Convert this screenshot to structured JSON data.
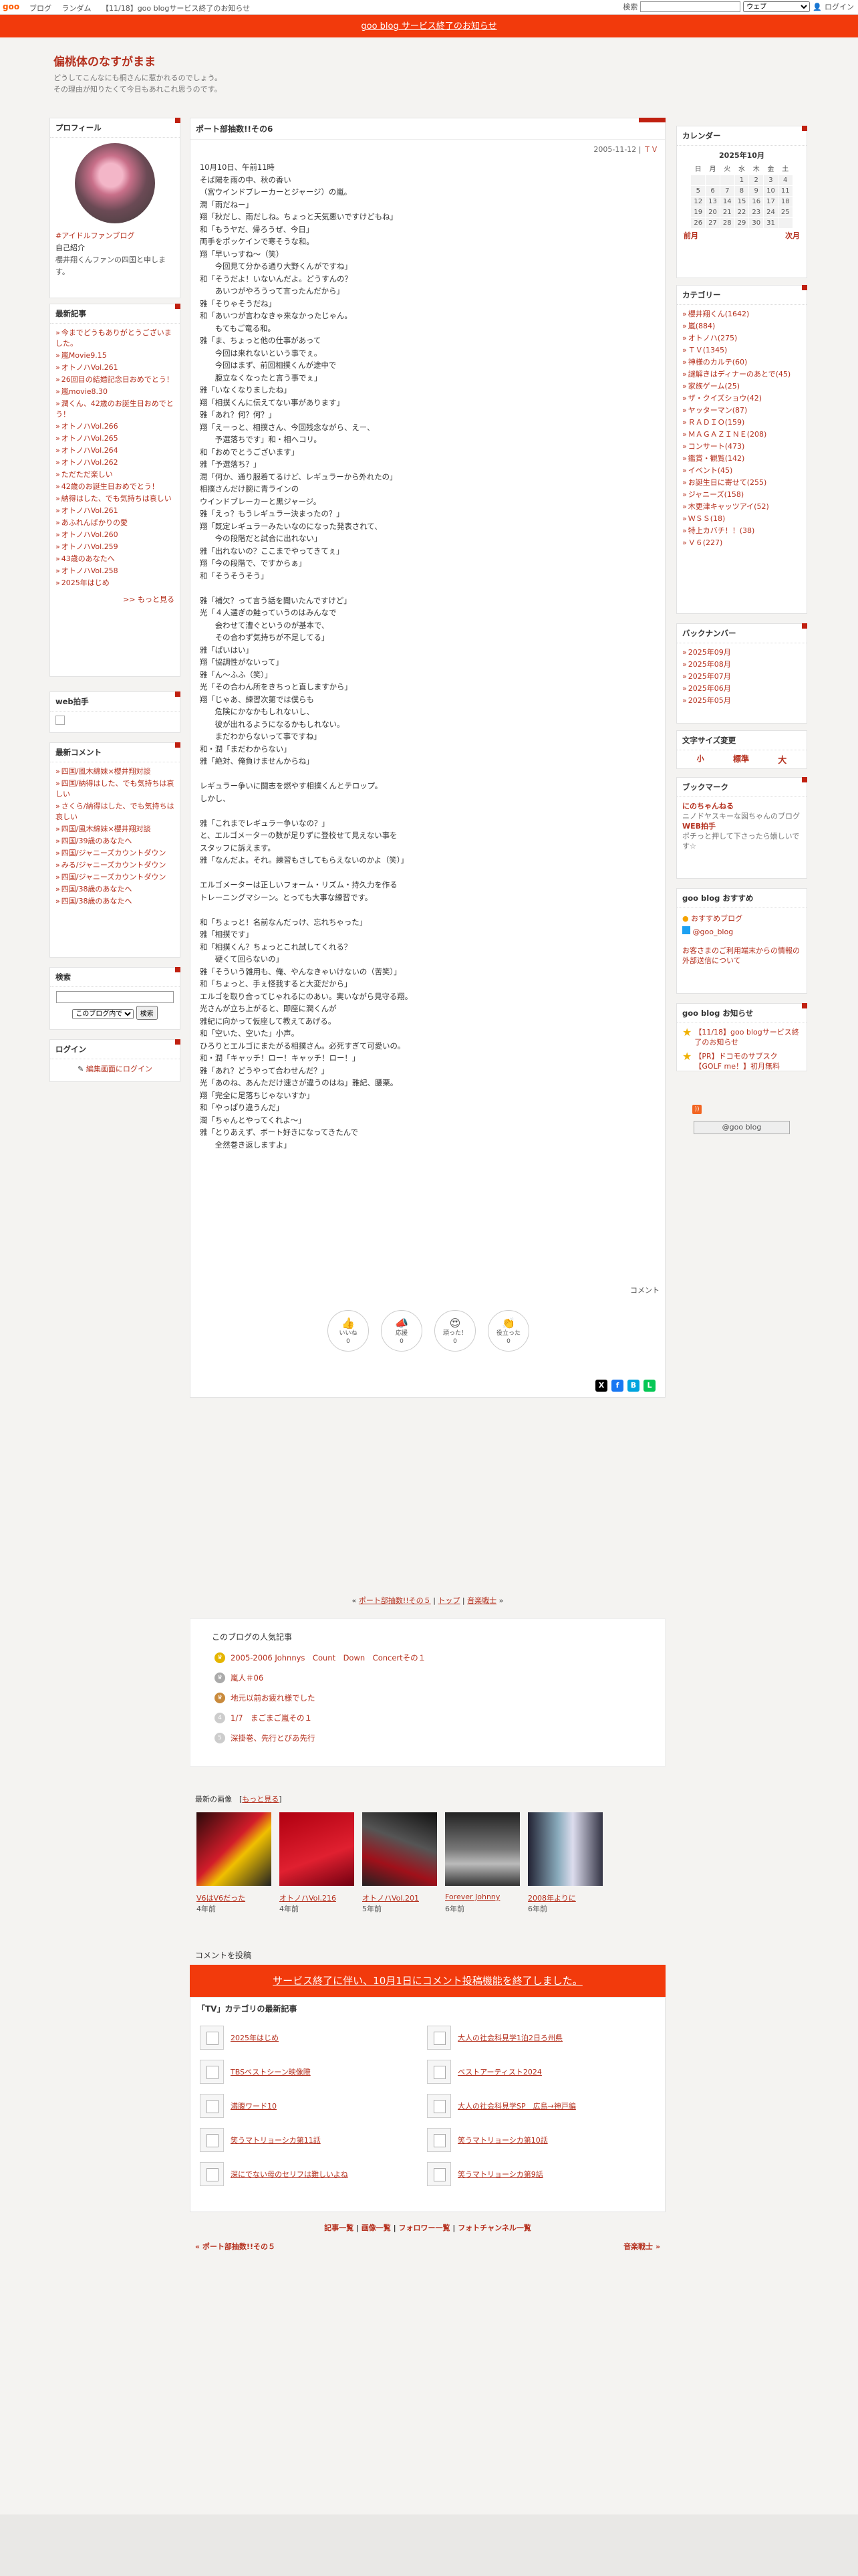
{
  "topbar": {
    "logo": "goo",
    "nav": [
      "ブログ",
      "ランダム",
      "【11/18】goo blogサービス終了のお知らせ"
    ],
    "search_label": "検索",
    "search_scope": "ウェブ",
    "login": "ログイン"
  },
  "notice": "goo blog サービス終了のお知らせ",
  "blog": {
    "title": "偏桃体のなすがまま",
    "description": [
      "どうしてこんなにも桐さんに惹かれるのでしょう。",
      "その理由が知りたくて今日もあれこれ思うのです。"
    ]
  },
  "profile": {
    "heading": "プロフィール",
    "link": "#アイドルファンブログ",
    "intro_label": "自己紹介",
    "intro": "櫻井翔くんファンの四国と申します。"
  },
  "recent": {
    "heading": "最新記事",
    "items": [
      "今までどうもありがとうございました。",
      "嵐Movie9.15",
      "オトノハVol.261",
      "26回目の結婚記念日おめでとう！",
      "嵐movie8.30",
      "潤くん、42歳のお誕生日おめでとう！",
      "オトノハVol.266",
      "オトノハVol.265",
      "オトノハVol.264",
      "オトノハVol.262",
      "ただただ楽しい",
      "42歳のお誕生日おめでとう！",
      "納得はした、でも気持ちは哀しい",
      "オトノハVol.261",
      "あふれんばかりの愛",
      "オトノハVol.260",
      "オトノハVol.259",
      "43歳のあなたへ",
      "オトノハVol.258",
      "2025年はじめ"
    ],
    "more": ">> もっと見る"
  },
  "webclap": {
    "heading": "web拍手"
  },
  "comments": {
    "heading": "最新コメント",
    "items": [
      "四国/風木綿妹×櫻井翔対談",
      "四国/納得はした、でも気持ちは哀しい",
      "さくら/納得はした、でも気持ちは哀しい",
      "四国/風木綿妹×櫻井翔対談",
      "四国/39歳のあなたへ",
      "四国/ジャニーズカウントダウン",
      "みる/ジャニーズカウントダウン",
      "四国/ジャニーズカウントダウン",
      "四国/38歳のあなたへ",
      "四国/38歳のあなたへ"
    ]
  },
  "search": {
    "heading": "検索",
    "scope": "このブログ内で",
    "button": "検索"
  },
  "login": {
    "heading": "ログイン",
    "link": "編集画面にログイン"
  },
  "calendar": {
    "heading": "カレンダー",
    "month": "2025年10月",
    "weekdays": [
      "日",
      "月",
      "火",
      "水",
      "木",
      "金",
      "土"
    ],
    "rows": [
      [
        "",
        "",
        "",
        "1",
        "2",
        "3",
        "4"
      ],
      [
        "5",
        "6",
        "7",
        "8",
        "9",
        "10",
        "11"
      ],
      [
        "12",
        "13",
        "14",
        "15",
        "16",
        "17",
        "18"
      ],
      [
        "19",
        "20",
        "21",
        "22",
        "23",
        "24",
        "25"
      ],
      [
        "26",
        "27",
        "28",
        "29",
        "30",
        "31",
        ""
      ]
    ],
    "prev": "前月",
    "next": "次月"
  },
  "categories": {
    "heading": "カテゴリー",
    "items": [
      "櫻井翔くん(1642)",
      "嵐(884)",
      "オトノハ(275)",
      "ＴＶ(1345)",
      "神様のカルテ(60)",
      "謎解きはディナーのあとで(45)",
      "家族ゲーム(25)",
      "ザ・クイズショウ(42)",
      "ヤッターマン(87)",
      "ＲＡＤＩＯ(159)",
      "ＭＡＧＡＺＩＮＥ(208)",
      "コンサート(473)",
      "鑑賞・観覧(142)",
      "イベント(45)",
      "お誕生日に寄せて(255)",
      "ジャニーズ(158)",
      "木更津キャッツアイ(52)",
      "ＷＳＳ(18)",
      "特上カバチ！！(38)",
      "Ｖ６(227)"
    ]
  },
  "backnumber": {
    "heading": "バックナンバー",
    "items": [
      "2025年09月",
      "2025年08月",
      "2025年07月",
      "2025年06月",
      "2025年05月"
    ]
  },
  "fontsize": {
    "heading": "文字サイズ変更",
    "small": "小",
    "medium": "標準",
    "large": "大"
  },
  "bookmark": {
    "heading": "ブックマーク",
    "items": [
      {
        "title": "にのちゃんねる",
        "desc": "ニノドヤスキーな図ちゃんのブログ"
      },
      {
        "title": "WEB拍手",
        "desc": "ポチっと押して下さったら嬉しいです☆"
      }
    ]
  },
  "recommend": {
    "heading": "goo blog おすすめ",
    "items": [
      "おすすめブログ",
      "@goo_blog"
    ],
    "notice": "お客さまのご利用端末からの情報の外部送信について"
  },
  "gooinfo": {
    "heading": "goo blog お知らせ",
    "items": [
      "【11/18】goo blogサービス終了のお知らせ",
      "【PR】ドコモのサブスク【GOLF me！】初月無料"
    ]
  },
  "goo_badge": "@goo blog",
  "entry": {
    "title": "ポート部抽数!!その6",
    "date": "2005-11-12",
    "date_tail": "ＴＶ",
    "body": "10月10日、午前11時\nそば陽を雨の中、秋の香い\n（宮ウインドブレーカーとジャージ）の嵐。\n潤「雨だねー」\n翔「秋だし、雨だしね。ちょっと天気悪いですけどもね」\n和「もうヤだ、帰ろうぜ、今日」\n両手をポッケインで寒そうな和。\n翔「早いっすね～（笑）\n　　今回見て分かる通り大野くんがですね」\n和「そうだよ！いないんだよ。どうすんの？\n　　あいつがやろうって言ったんだから」\n雅「そりゃそうだね」\n和「あいつが言わなきゃ来なかったじゃん。\n　　もてもご竜る和。\n雅「ま、ちょっと他の仕事があって\n　　今回は来れないという事でぇ。\n　　今回はまず、前回相撲くんが途中で\n　　腹立なくなったと言う事でぇ」\n雅「いなくなりましたね」\n翔「相撲くんに伝えてない事があります」\n雅「あれ？何？何？」\n翔「えーっと、相撲さん、今回残念ながら、えー、\n　　予選落ちです」和・相へコリ。\n和「おめでとうございます」\n雅「予選落ち？」\n潤「何か、通り服着てるけど、レギュラーから外れたの」\n相撲さんだけ腕に青ラインの\nウインドブレーカーと黒ジャージ。\n雅「えっ？もうレギュラー決まったの？」\n翔「既定レギュラーみたいなのになった発表されて、\n　　今の段階だと試合に出れない」\n雅「出れないの？ここまでやってきてぇ」\n翔「今の段階で、ですからぁ」\n和「そうそうそう」\n\n雅「補欠？って言う話を聞いたんですけど」\n光「４人選ぎの鮭っていうのはみんなで\n　　会わせて漕ぐというのが基本で、\n　　その合わず気持ちが不足してる」\n雅「ぱいはい」\n翔「協調性がないって」\n雅「ん～ふふ（笑）」\n光「その合わん所をきちっと直しますから」\n翔「じゃあ、練習次第では僕らも\n　　危険にかなかもしれないし、\n　　彼が出れるようになるかもしれない。\n　　まだわからないって事ですね」\n和・潤「まだわからない」\n雅「絶対、俺負けませんからね」\n\nレギュラー争いに闘志を燃やす相撲くんとテロップ。\nしかし、\n\n雅「これまでレギュラー争いなの？」\nと、エルゴメーターの数が足りずに登校せて見えない事を\nスタッフに訴えます。\n雅「なんだよ。それ。練習もさしてもらえないのかよ（笑）」\n\nエルゴメーターは正しいフォーム・リズム・持久力を作る\nトレーニングマシーン。とっても大事な練習です。\n\n和「ちょっと！名前なんだっけ、忘れちゃった」\n雅「相撲です」\n和「相撲くん？ちょっとこれ試してくれる？\n　　硬くて回らないの」\n雅「そういう雑用も、俺、やんなきゃいけないの（苦笑）」\n和「ちょっと、手ぇ怪我すると大変だから」\nエルゴを取り合ってじゃれるにのあい。実いながら見守る翔。\n光さんが立ち上がると、即座に潤くんが\n雅紀に向かって仮座して教えてあげる。\n和「空いた、空いた」小声。\nひろりとエルゴにまたがる相撲さん。必死すぎて可愛いの。\n和・潤「キャッチ！ロー！キャッチ！ロー！」\n雅「あれ？どうやって合わせんだ？」\n光「あのね、あんただけ速さが違うのはね」雅紀、腰栗。\n翔「完全に足落ちじゃないすか」\n和「やっぱり違うんだ」\n潤「ちゃんとやってくれよ～」\n雅「とりあえず、ボート好きになってきたんで\n　　全然巻き返しますよ」",
    "comment_link": "コメント",
    "reactions": [
      {
        "label": "いいね",
        "count": "0",
        "icon": "thumbs-up-icon"
      },
      {
        "label": "応援",
        "count": "0",
        "icon": "megaphone-icon"
      },
      {
        "label": "頑った！",
        "count": "0",
        "icon": "heart-eyes-icon"
      },
      {
        "label": "役立った",
        "count": "0",
        "icon": "clap-icon"
      }
    ]
  },
  "entry_nav": {
    "prev": "ポート部抽数!!その５",
    "top": "トップ",
    "next": "音楽戦士"
  },
  "popular": {
    "heading": "このブログの人気記事",
    "items": [
      "2005-2006 Johnnys　Count　Down　Concertその１",
      "嵐人＃06",
      "地元以前お疲れ様でした",
      "1/7　まごまご嵐その１",
      "深掛巻、先行とびあ先行"
    ]
  },
  "images": {
    "heading": "最新の画像",
    "more": "もっと見る",
    "items": [
      {
        "name": "V6はV6だった",
        "age": "4年前"
      },
      {
        "name": "オトノハVol.216",
        "age": "4年前"
      },
      {
        "name": "オトノハVol.201",
        "age": "5年前"
      },
      {
        "name": "Forever Johnny",
        "age": "6年前"
      },
      {
        "name": "2008年よりに",
        "age": "6年前"
      }
    ]
  },
  "comment_form": {
    "heading": "コメントを投稿",
    "closed": "サービス終了に伴い、10月1日にコメント投稿機能を終了しました。"
  },
  "category_box": {
    "heading": "「TV」カテゴリの最新記事",
    "left": [
      "2025年はじめ",
      "TBSベストシーン映像際",
      "満腹ワード10",
      "笑うマトリョーシカ第11話",
      "深にでない母のセリフは難しいよね"
    ],
    "right": [
      "大人の社会科見学1泊2日ろ州県",
      "ベストアーティスト2024",
      "大人の社会科見学SP　広島→神戸編",
      "笑うマトリョーシカ第10話",
      "笑うマトリョーシカ第9話"
    ]
  },
  "footer_nav": [
    "記事一覧",
    "画像一覧",
    "フォロワー一覧",
    "フォトチャンネル一覧"
  ],
  "footer_prev": "« ポート部抽数!!その５",
  "footer_next": "音楽戦士 »"
}
